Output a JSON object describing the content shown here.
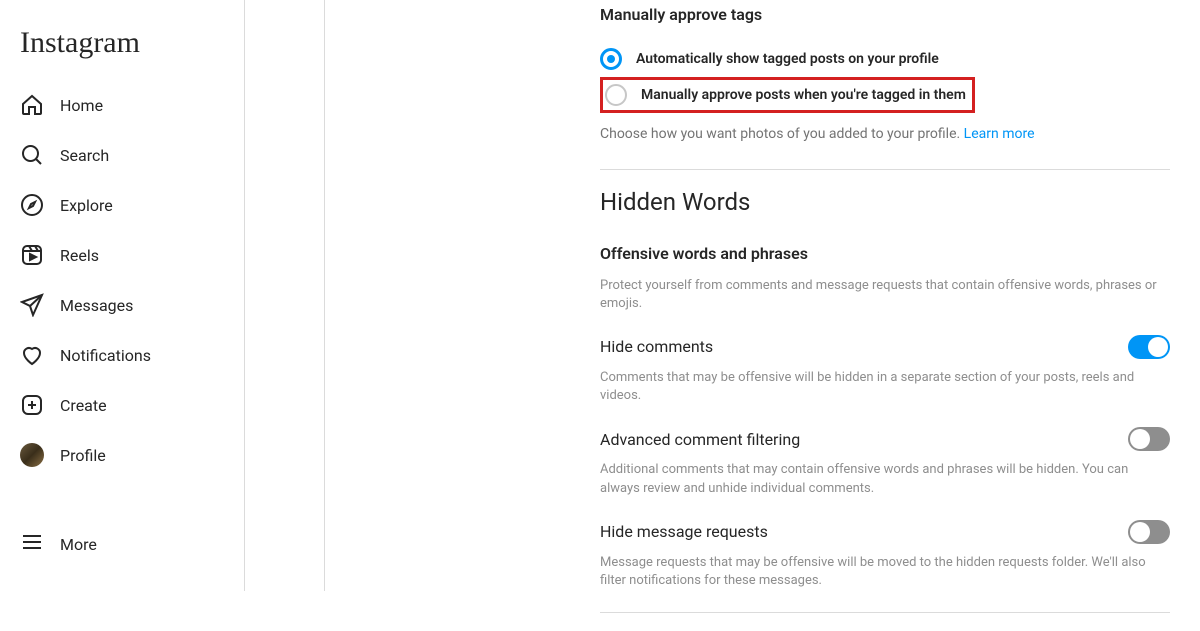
{
  "brand": "Instagram",
  "sidebar": {
    "items": [
      {
        "label": "Home"
      },
      {
        "label": "Search"
      },
      {
        "label": "Explore"
      },
      {
        "label": "Reels"
      },
      {
        "label": "Messages"
      },
      {
        "label": "Notifications"
      },
      {
        "label": "Create"
      },
      {
        "label": "Profile"
      }
    ],
    "more": "More"
  },
  "tags": {
    "heading": "Manually approve tags",
    "option_auto": "Automatically show tagged posts on your profile",
    "option_manual": "Manually approve posts when you're tagged in them",
    "helper": "Choose how you want photos of you added to your profile. ",
    "learn_more": "Learn more",
    "selected": "auto"
  },
  "hidden_words": {
    "heading": "Hidden Words",
    "offensive_heading": "Offensive words and phrases",
    "offensive_desc": "Protect yourself from comments and message requests that contain offensive words, phrases or emojis.",
    "hide_comments": {
      "label": "Hide comments",
      "enabled": true,
      "desc": "Comments that may be offensive will be hidden in a separate section of your posts, reels and videos."
    },
    "advanced_filtering": {
      "label": "Advanced comment filtering",
      "enabled": false,
      "desc": "Additional comments that may contain offensive words and phrases will be hidden. You can always review and unhide individual comments."
    },
    "hide_requests": {
      "label": "Hide message requests",
      "enabled": false,
      "desc": "Message requests that may be offensive will be moved to the hidden requests folder. We'll also filter notifications for these messages."
    }
  }
}
